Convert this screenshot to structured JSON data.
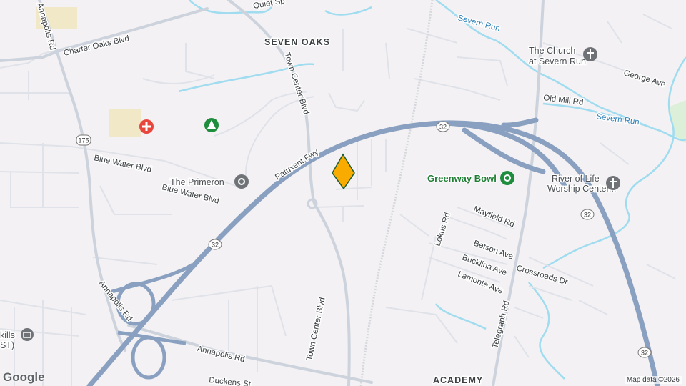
{
  "map": {
    "area_labels": {
      "seven_oaks": "SEVEN OAKS",
      "academy": "ACADEMY"
    },
    "roads": {
      "charter_oaks": "Charter Oaks Blvd",
      "annapolis_rd_top": "Annapolis Rd",
      "town_center_top": "Town Center Blvd",
      "patuxent_fwy": "Patuxent Fwy",
      "blue_water_1": "Blue Water Blvd",
      "blue_water_2": "Blue Water Blvd",
      "old_mill": "Old Mill Rd",
      "george_ave": "George Ave",
      "mayfield": "Mayfield Rd",
      "lokus": "Lokus Rd",
      "betson": "Betson Ave",
      "bucklina": "Bucklina Ave",
      "lamonte": "Lamonte Ave",
      "crossroads": "Crossroads Dr",
      "telegraph": "Telegraph Rd",
      "town_center_bottom": "Town Center Blvd",
      "annapolis_rd_bottom": "Annapolis Rd",
      "annapolis_rd_left": "Annapolis Rd",
      "duckens": "Duckens St",
      "quiet": "Quiet Sp"
    },
    "water": {
      "severn_run_top": "Severn Run",
      "severn_run_right": "Severn Run"
    },
    "pois": {
      "church": [
        "The Church",
        "at Severn Run"
      ],
      "greenway": "Greenway Bowl",
      "river_of_life": [
        "River of Life",
        "Worship Center..."
      ],
      "primeron": "The Primeron",
      "skills": [
        "kills",
        "ST)"
      ]
    },
    "shields": {
      "r32a": "32",
      "r32b": "32",
      "r32c": "32",
      "r32d": "32",
      "r175": "175"
    },
    "colors": {
      "background": "#f3f1f3",
      "highway": "#8aa0c0",
      "water": "#9fdcf0",
      "marker": "#f9ab00",
      "poi_green": "#1e8e3e",
      "poi_gray": "#6f7378",
      "hospital": "#e8453c"
    },
    "attribution": "Map data ©2026",
    "logo": "Google"
  }
}
